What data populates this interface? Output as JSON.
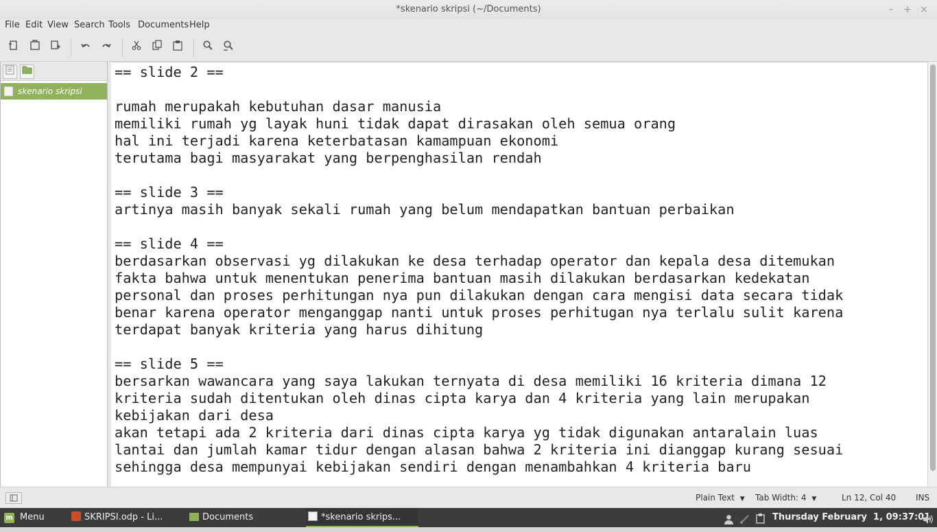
{
  "window": {
    "title": "*skenario skripsi (~/Documents)",
    "controls": [
      "–",
      "+",
      "×"
    ]
  },
  "menu": [
    "File",
    "Edit",
    "View",
    "Search",
    "Tools",
    "Documents",
    "Help"
  ],
  "toolbar": {
    "icons": [
      "new-document",
      "open",
      "save-as",
      "undo",
      "redo",
      "cut",
      "copy",
      "paste",
      "find",
      "find-replace"
    ]
  },
  "sidebar": {
    "documents": [
      {
        "name": "skenario skripsi"
      }
    ]
  },
  "editor": {
    "text": "== slide 2 ==\n\nrumah merupakah kebutuhan dasar manusia\nmemiliki rumah yg layak huni tidak dapat dirasakan oleh semua orang\nhal ini terjadi karena keterbatasan kamampuan ekonomi\nterutama bagi masyarakat yang berpenghasilan rendah\n\n== slide 3 ==\nartinya masih banyak sekali rumah yang belum mendapatkan bantuan perbaikan\n\n== slide 4 ==\nberdasarkan observasi yg dilakukan ke desa terhadap operator dan kepala desa ditemukan\nfakta bahwa untuk menentukan penerima bantuan masih dilakukan berdasarkan kedekatan\npersonal dan proses perhitungan nya pun dilakukan dengan cara mengisi data secara tidak\nbenar karena operator menganggap nanti untuk proses perhitugan nya terlalu sulit karena\nterdapat banyak kriteria yang harus dihitung\n\n== slide 5 ==\nbersarkan wawancara yang saya lakukan ternyata di desa memiliki 16 kriteria dimana 12\nkriteria sudah ditentukan oleh dinas cipta karya dan 4 kriteria yang lain merupakan\nkebijakan dari desa\nakan tetapi ada 2 kriteria dari dinas cipta karya yg tidak digunakan antaralain luas\nlantai dan jumlah kamar tidur dengan alasan bahwa 2 kriteria ini dianggap kurang sesuai\nsehingga desa mempunyai kebijakan sendiri dengan menambahkan 4 kriteria baru"
  },
  "status": {
    "language": "Plain Text",
    "tab_width": "Tab Width: 4",
    "position": "Ln 12, Col 40",
    "mode": "INS"
  },
  "panel": {
    "menu_label": "Menu",
    "tasks": [
      {
        "label": "SKRIPSI.odp - Li..."
      },
      {
        "label": "Documents"
      },
      {
        "label": "*skenario skrips..."
      }
    ],
    "clock": "Thursday February  1, 09:37:01"
  },
  "colors": {
    "accent": "#8fb25a",
    "panel_bg": "#3c3c3c"
  }
}
